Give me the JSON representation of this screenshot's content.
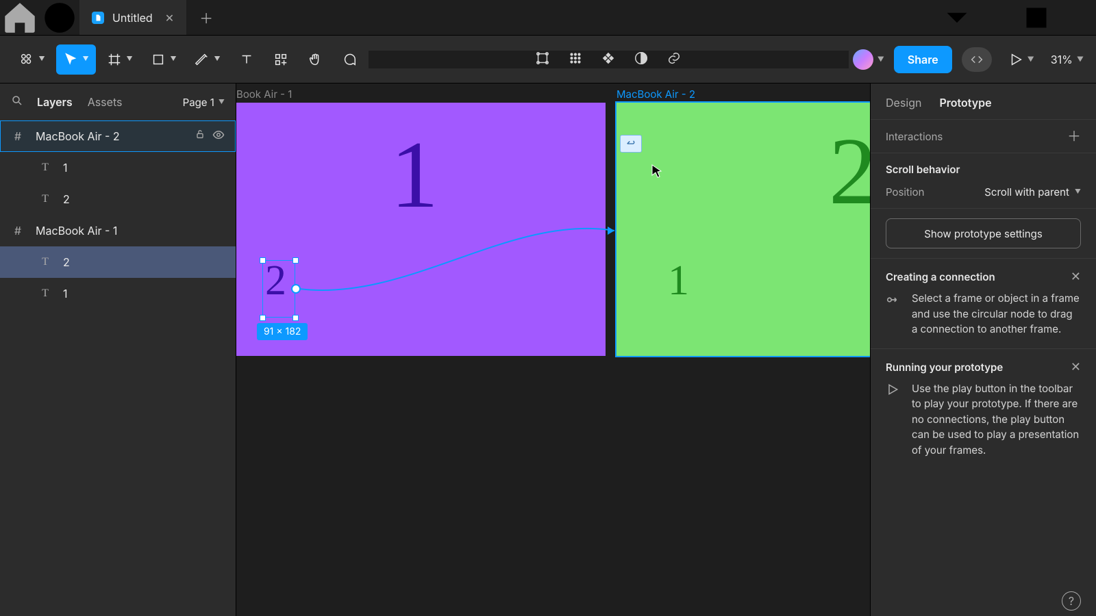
{
  "title_tab": {
    "label": "Untitled"
  },
  "toolbar": {
    "share_label": "Share",
    "zoom_label": "31%"
  },
  "left_panel": {
    "tabs": {
      "layers": "Layers",
      "assets": "Assets"
    },
    "page_label": "Page 1",
    "tree": [
      {
        "name": "MacBook Air - 2",
        "kind": "frame",
        "selected_frame": true,
        "children": [
          {
            "name": "1",
            "kind": "text"
          },
          {
            "name": "2",
            "kind": "text"
          }
        ]
      },
      {
        "name": "MacBook Air - 1",
        "kind": "frame",
        "children": [
          {
            "name": "2",
            "kind": "text",
            "selected_row": true
          },
          {
            "name": "1",
            "kind": "text"
          }
        ]
      }
    ]
  },
  "canvas": {
    "frame_a_label": "Book Air - 1",
    "frame_b_label": "MacBook Air - 2",
    "frame_a_big": "1",
    "frame_a_small": "2",
    "frame_b_big": "2",
    "frame_b_small": "1",
    "selection_dims": "91 × 182"
  },
  "right_panel": {
    "tabs": {
      "design": "Design",
      "prototype": "Prototype"
    },
    "interactions_label": "Interactions",
    "scroll_title": "Scroll behavior",
    "scroll_position_label": "Position",
    "scroll_position_value": "Scroll with parent",
    "proto_settings_btn": "Show prototype settings",
    "tips": [
      {
        "title": "Creating a connection",
        "body": "Select a frame or object in a frame and use the circular node to drag a connection to another frame."
      },
      {
        "title": "Running your prototype",
        "body": "Use the play button in the toolbar to play your prototype. If there are no connections, the play button can be used to play a presentation of your frames."
      }
    ]
  }
}
